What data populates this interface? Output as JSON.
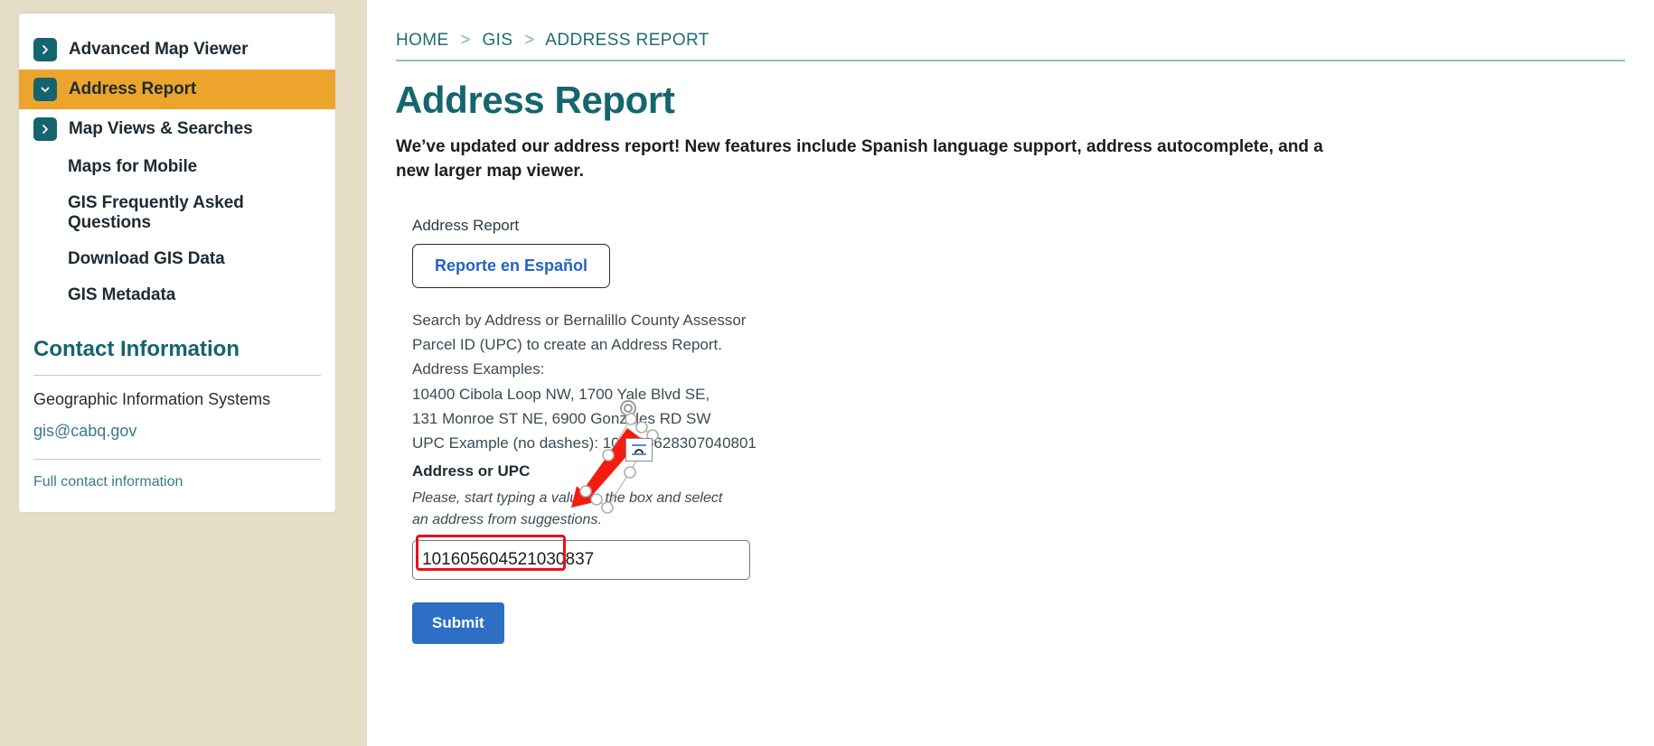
{
  "sidebar": {
    "items": [
      {
        "label": "Advanced Map Viewer",
        "icon": "chevron-right-icon",
        "active": false,
        "has_icon": true
      },
      {
        "label": "Address Report",
        "icon": "chevron-down-icon",
        "active": true,
        "has_icon": true
      },
      {
        "label": "Map Views & Searches",
        "icon": "chevron-right-icon",
        "active": false,
        "has_icon": true
      }
    ],
    "sub_items": [
      {
        "label": "Maps for Mobile"
      },
      {
        "label": "GIS Frequently Asked Questions"
      },
      {
        "label": "Download GIS Data"
      },
      {
        "label": "GIS Metadata"
      }
    ],
    "contact": {
      "heading": "Contact Information",
      "department": "Geographic Information Systems",
      "email": "gis@cabq.gov",
      "full_contact_link": "Full contact information"
    }
  },
  "breadcrumb": {
    "items": [
      "HOME",
      "GIS",
      "ADDRESS REPORT"
    ],
    "separator": ">"
  },
  "main": {
    "title": "Address Report",
    "intro": "We’ve updated our address report! New features include Spanish language support, address autocomplete, and a new larger map viewer."
  },
  "form": {
    "section_label": "Address Report",
    "language_button": "Reporte en Español",
    "help_lines": [
      "Search by Address or Bernalillo County Assessor",
      "Parcel ID (UPC) to create an Address Report.",
      "Address Examples:",
      "10400 Cibola Loop NW, 1700 Yale Blvd SE,",
      "131 Monroe ST NE, 6900 Gonzales RD SW",
      "UPC Example (no dashes): 101405628307040801"
    ],
    "field_label": "Address or UPC",
    "field_hint": "Please, start typing a value in the box and select an address from suggestions.",
    "input_value": "101605604521030837",
    "input_placeholder": "",
    "submit_label": "Submit"
  },
  "annotation": {
    "type": "red-arrow",
    "selected": true,
    "wrap_icon": "text-wrap-icon",
    "highlight_color": "#e8121a"
  },
  "colors": {
    "teal": "#14646f",
    "orange_active": "#eda42c",
    "beige_gutter": "#e5dcc5",
    "link_blue": "#2563c4",
    "submit_blue": "#2c6fc4",
    "annotation_red": "#e8121a"
  }
}
